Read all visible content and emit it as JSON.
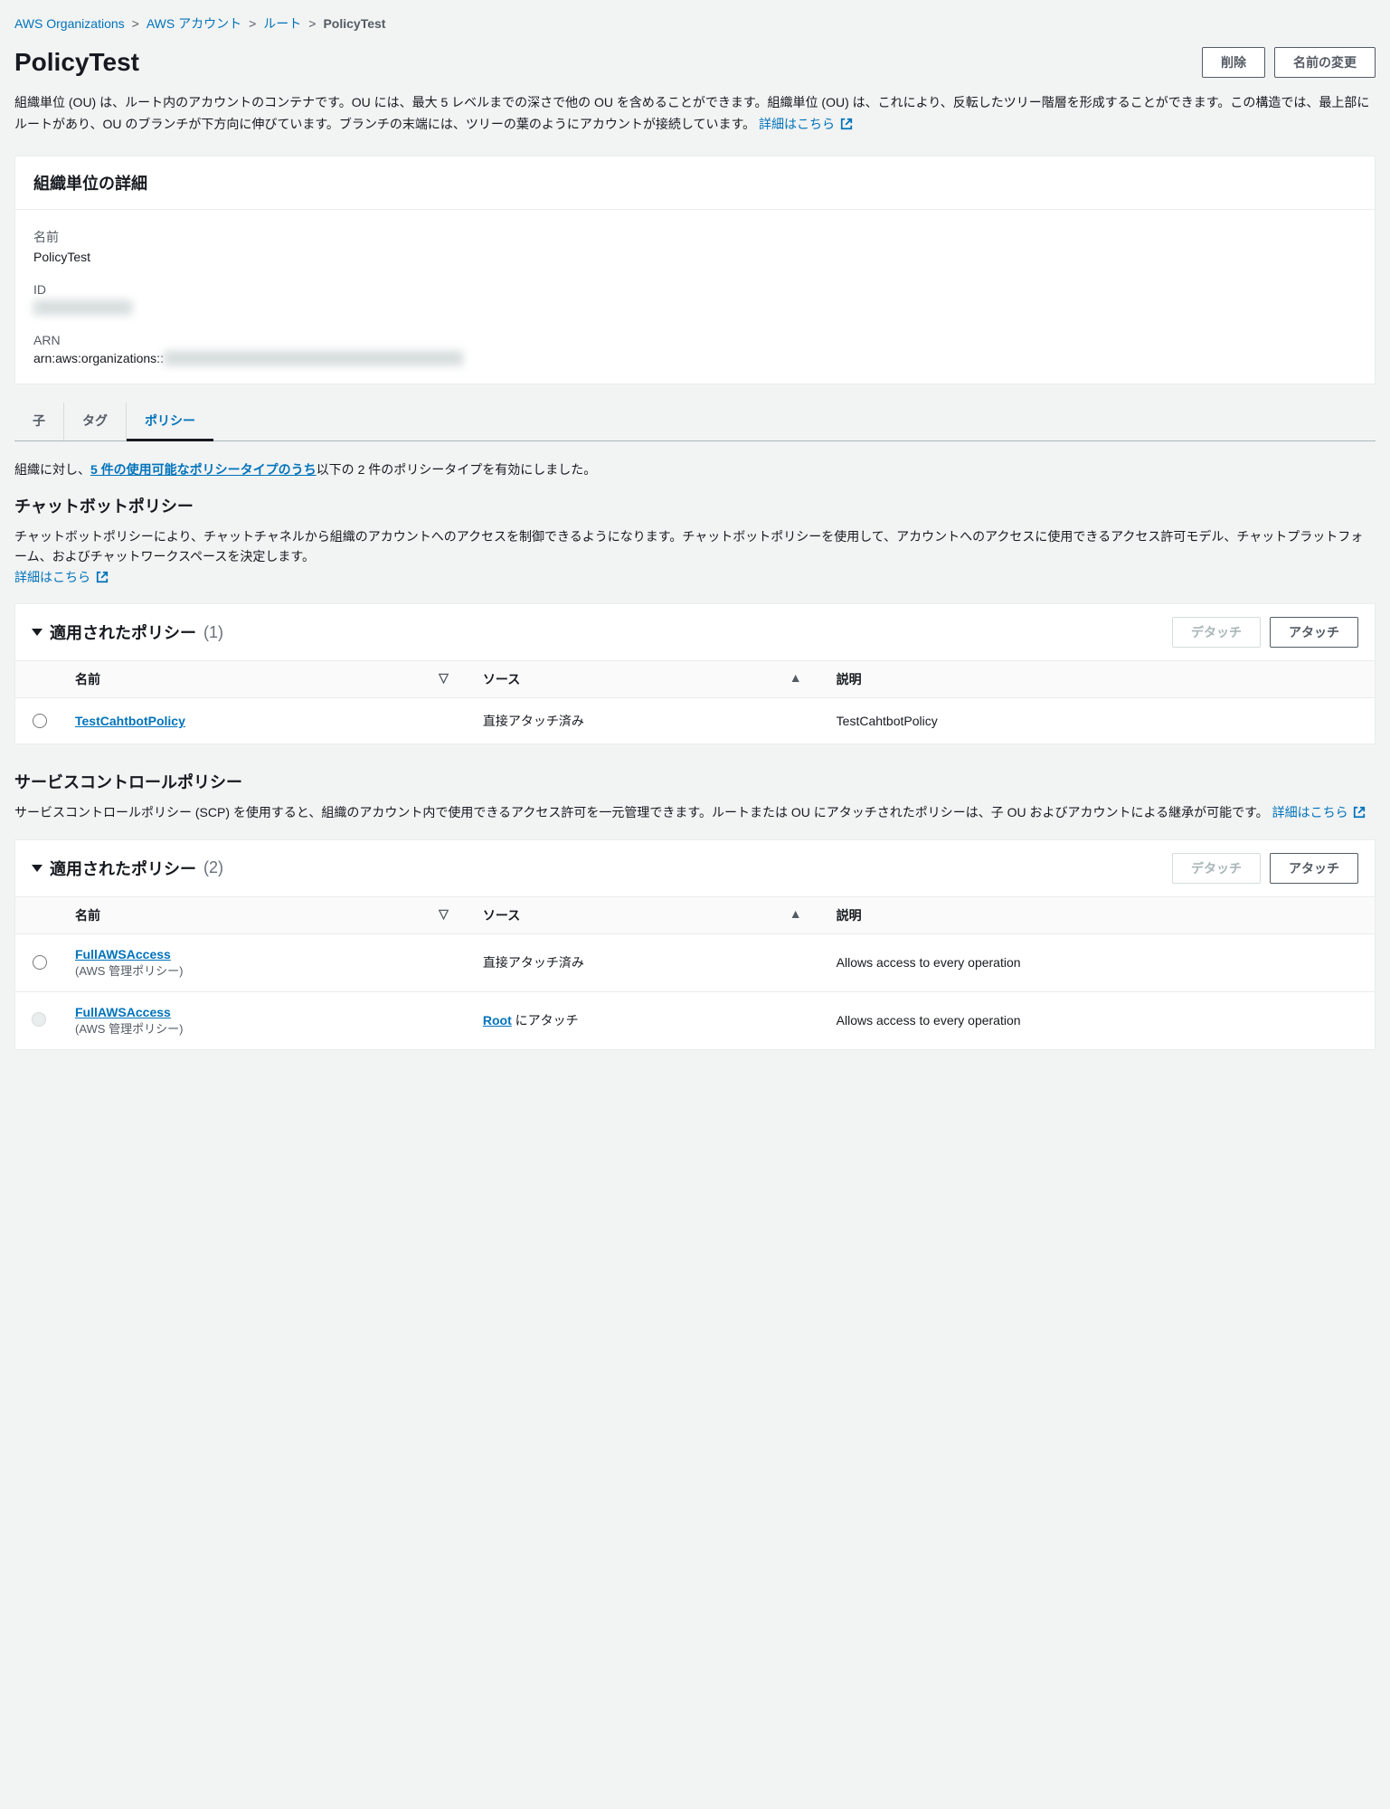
{
  "breadcrumb": {
    "item1": "AWS Organizations",
    "item2": "AWS アカウント",
    "item3": "ルート",
    "current": "PolicyTest"
  },
  "page": {
    "title": "PolicyTest",
    "delete_btn": "削除",
    "rename_btn": "名前の変更",
    "description": "組織単位 (OU) は、ルート内のアカウントのコンテナです。OU には、最大 5 レベルまでの深さで他の OU を含めることができます。組織単位 (OU) は、これにより、反転したツリー階層を形成することができます。この構造では、最上部にルートがあり、OU のブランチが下方向に伸びています。ブランチの末端には、ツリーの葉のようにアカウントが接続しています。 ",
    "learn_more": "詳細はこちら"
  },
  "details": {
    "header": "組織単位の詳細",
    "name_label": "名前",
    "name_value": "PolicyTest",
    "id_label": "ID",
    "id_value": "ou-xxxx-xxxxxxxx",
    "arn_label": "ARN",
    "arn_prefix": "arn:aws:organizations::",
    "arn_hidden": "XXXXXXXXXXXX:ou/o-xxxxxxxxxx/ou-xxxx-xxxxxxxx"
  },
  "tabs": {
    "children": "子",
    "tags": "タグ",
    "policies": "ポリシー"
  },
  "policy_intro_prefix": "組織に対し、",
  "policy_intro_link": "5 件の使用可能なポリシータイプのうち",
  "policy_intro_suffix": "以下の 2 件のポリシータイプを有効にしました。",
  "chatbot": {
    "title": "チャットボットポリシー",
    "description": "チャットボットポリシーにより、チャットチャネルから組織のアカウントへのアクセスを制御できるようになります。チャットボットポリシーを使用して、アカウントへのアクセスに使用できるアクセス許可モデル、チャットプラットフォーム、およびチャットワークスペースを決定します。",
    "learn_more": "詳細はこちら",
    "applied_title": "適用されたポリシー",
    "applied_count": "(1)",
    "detach_btn": "デタッチ",
    "attach_btn": "アタッチ",
    "col_name": "名前",
    "col_source": "ソース",
    "col_desc": "説明",
    "row": {
      "name": "TestCahtbotPolicy",
      "source": "直接アタッチ済み",
      "desc": "TestCahtbotPolicy"
    }
  },
  "scp": {
    "title": "サービスコントロールポリシー",
    "description": "サービスコントロールポリシー (SCP) を使用すると、組織のアカウント内で使用できるアクセス許可を一元管理できます。ルートまたは OU にアタッチされたポリシーは、子 OU およびアカウントによる継承が可能です。 ",
    "learn_more": "詳細はこちら",
    "applied_title": "適用されたポリシー",
    "applied_count": "(2)",
    "detach_btn": "デタッチ",
    "attach_btn": "アタッチ",
    "col_name": "名前",
    "col_source": "ソース",
    "col_desc": "説明",
    "row1": {
      "name": "FullAWSAccess",
      "sub": "(AWS 管理ポリシー)",
      "source": "直接アタッチ済み",
      "desc": "Allows access to every operation"
    },
    "row2": {
      "name": "FullAWSAccess",
      "sub": "(AWS 管理ポリシー)",
      "source_link": "Root",
      "source_suffix": " にアタッチ",
      "desc": "Allows access to every operation"
    }
  }
}
